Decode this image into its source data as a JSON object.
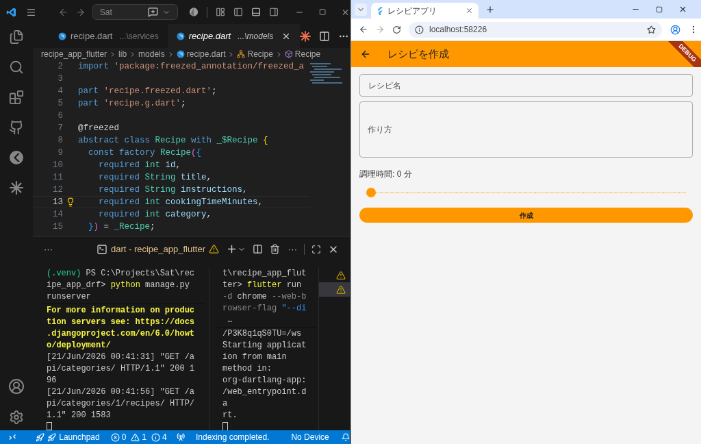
{
  "vscode": {
    "title_bar": {
      "search": "Sat"
    },
    "tabs": [
      {
        "label": "recipe.dart",
        "description": "...\\services",
        "selected": false
      },
      {
        "label": "recipe.dart",
        "description": "...\\models",
        "selected": true
      }
    ],
    "breadcrumbs": [
      {
        "label": "recipe_app_flutter",
        "kind": "folder"
      },
      {
        "label": "lib",
        "kind": "folder"
      },
      {
        "label": "models",
        "kind": "folder"
      },
      {
        "label": "recipe.dart",
        "kind": "file"
      },
      {
        "label": "Recipe",
        "kind": "class"
      },
      {
        "label": "Recipe",
        "kind": "constructor"
      }
    ],
    "code_lines": [
      {
        "n": "2",
        "current": false,
        "tokens": [
          {
            "t": "import ",
            "kind": "kw"
          },
          {
            "t": "'package:freezed_annotation/freezed_a",
            "kind": "str"
          }
        ]
      },
      {
        "n": "3",
        "current": false
      },
      {
        "n": "4",
        "current": false,
        "tokens": [
          {
            "t": "part ",
            "kind": "kw"
          },
          {
            "t": "'recipe.freezed.dart'",
            "kind": "str"
          },
          {
            "t": ";",
            "kind": "punct"
          }
        ]
      },
      {
        "n": "5",
        "current": false,
        "tokens": [
          {
            "t": "part ",
            "kind": "kw"
          },
          {
            "t": "'recipe.g.dart'",
            "kind": "str"
          },
          {
            "t": ";",
            "kind": "punct"
          }
        ]
      },
      {
        "n": "6",
        "current": false
      },
      {
        "n": "7",
        "current": false,
        "tokens": [
          {
            "t": "@freezed",
            "kind": "punct"
          }
        ]
      },
      {
        "n": "8",
        "current": false,
        "tokens": [
          {
            "t": "abstract class ",
            "kind": "kw"
          },
          {
            "t": "Recipe ",
            "kind": "type"
          },
          {
            "t": "with ",
            "kind": "kw"
          },
          {
            "t": "_$Recipe ",
            "kind": "type"
          },
          {
            "t": "{",
            "kind": "b1"
          }
        ]
      },
      {
        "n": "9",
        "current": false,
        "tokens": [
          {
            "t": "  const factory ",
            "kind": "kw"
          },
          {
            "t": "Recipe",
            "kind": "type"
          },
          {
            "t": "(",
            "kind": "b2"
          },
          {
            "t": "{",
            "kind": "b3"
          }
        ]
      },
      {
        "n": "10",
        "current": false,
        "tokens": [
          {
            "t": "    required ",
            "kind": "kw"
          },
          {
            "t": "int ",
            "kind": "type"
          },
          {
            "t": "id",
            "kind": "var"
          },
          {
            "t": ",",
            "kind": "punct"
          }
        ]
      },
      {
        "n": "11",
        "current": false,
        "tokens": [
          {
            "t": "    required ",
            "kind": "kw"
          },
          {
            "t": "String ",
            "kind": "type"
          },
          {
            "t": "title",
            "kind": "var"
          },
          {
            "t": ",",
            "kind": "punct"
          }
        ]
      },
      {
        "n": "12",
        "current": false,
        "tokens": [
          {
            "t": "    required ",
            "kind": "kw"
          },
          {
            "t": "String ",
            "kind": "type"
          },
          {
            "t": "instructions",
            "kind": "var"
          },
          {
            "t": ",",
            "kind": "punct"
          }
        ]
      },
      {
        "n": "13",
        "current": true,
        "tokens": [
          {
            "t": "    required ",
            "kind": "kw"
          },
          {
            "t": "int ",
            "kind": "type"
          },
          {
            "t": "cookingTimeMinutes",
            "kind": "var"
          },
          {
            "t": ",",
            "kind": "punct"
          }
        ]
      },
      {
        "n": "14",
        "current": false,
        "tokens": [
          {
            "t": "    required ",
            "kind": "kw"
          },
          {
            "t": "int ",
            "kind": "type"
          },
          {
            "t": "category",
            "kind": "var"
          },
          {
            "t": ",",
            "kind": "punct"
          }
        ]
      },
      {
        "n": "15",
        "current": false,
        "tokens": [
          {
            "t": "  }",
            "kind": "b3"
          },
          {
            "t": ")",
            "kind": "b2"
          },
          {
            "t": " = ",
            "kind": "punct"
          },
          {
            "t": "_Recipe",
            "kind": "type"
          },
          {
            "t": ";",
            "kind": "punct"
          }
        ]
      }
    ],
    "panel": {
      "more": "···",
      "terminal_tab": "dart - recipe_app_flutter",
      "header_more": "···",
      "left_pane": {
        "command": [
          [
            {
              "t": "(.venv)",
              "kind": "green"
            },
            {
              "t": " PS C:\\Projects\\Sat\\rec",
              "kind": "plain"
            }
          ],
          [
            {
              "t": "ipe_app_drf> ",
              "kind": "plain"
            },
            {
              "t": "python",
              "kind": "yellow"
            },
            {
              "t": " manage.py",
              "kind": "plain"
            }
          ],
          [
            {
              "t": "runserver",
              "kind": "plain"
            }
          ]
        ],
        "output": [
          [
            {
              "t": "For more information on produc",
              "kind": "bold"
            }
          ],
          [
            {
              "t": "tion servers see: https://docs",
              "kind": "bold"
            }
          ],
          [
            {
              "t": ".djangoproject.com/en/6.0/howt",
              "kind": "bold"
            }
          ],
          [
            {
              "t": "o/deployment/",
              "kind": "bold"
            }
          ],
          [
            {
              "t": "[21/Jun/2026 00:41:31] \"GET /a",
              "kind": "plain"
            }
          ],
          [
            {
              "t": "pi/categories/ HTTP/1.1\" 200 1",
              "kind": "plain"
            }
          ],
          [
            {
              "t": "96",
              "kind": "plain"
            }
          ],
          [
            {
              "t": "[21/Jun/2026 00:41:56] \"GET /a",
              "kind": "plain"
            }
          ],
          [
            {
              "t": "pi/categories/1/recipes/ HTTP/",
              "kind": "plain"
            }
          ],
          [
            {
              "t": "1.1\" 200 1583",
              "kind": "plain"
            }
          ]
        ]
      },
      "right_pane": {
        "command": [
          [
            {
              "t": "t\\recipe_app_flut",
              "kind": "plain"
            }
          ],
          [
            {
              "t": "ter> ",
              "kind": "plain"
            },
            {
              "t": "flutter",
              "kind": "yellow"
            },
            {
              "t": " run",
              "kind": "plain"
            }
          ],
          [
            {
              "t": "-d ",
              "kind": "gray"
            },
            {
              "t": "chrome",
              "kind": "plain"
            },
            {
              "t": " --web-b",
              "kind": "gray"
            }
          ],
          [
            {
              "t": "rowser-flag ",
              "kind": "gray"
            },
            {
              "t": "\"--di",
              "kind": "blue"
            }
          ],
          [
            {
              "t": " …",
              "kind": "plain"
            }
          ]
        ],
        "output": [
          [
            {
              "t": "/P3K8q1qS0TU=/ws",
              "kind": "plain"
            }
          ],
          [
            {
              "t": "Starting applicat",
              "kind": "plain"
            }
          ],
          [
            {
              "t": "ion from main",
              "kind": "plain"
            }
          ],
          [
            {
              "t": "method in:",
              "kind": "plain"
            }
          ],
          [
            {
              "t": "org-dartlang-app:",
              "kind": "plain"
            }
          ],
          [
            {
              "t": "/web_entrypoint.d",
              "kind": "plain"
            }
          ],
          [
            {
              "t": "a",
              "kind": "plain"
            }
          ],
          [
            {
              "t": "rt.",
              "kind": "plain"
            }
          ]
        ]
      },
      "terminal_list": [
        {
          "selected": false
        },
        {
          "selected": true
        }
      ]
    },
    "status_bar": {
      "launchpad": "Launchpad",
      "errors": "0",
      "warnings": "1",
      "infos": "4",
      "indexing": "Indexing completed.",
      "device": "No Device"
    }
  },
  "browser": {
    "tab_title": "レシピアプリ",
    "url": "localhost:58226",
    "app": {
      "title": "レシピを作成",
      "debug_banner": "DEBUG",
      "name_field": {
        "placeholder": "レシピ名"
      },
      "instructions_field": {
        "placeholder": "作り方"
      },
      "cooking_time_label": "調理時間: 0 分",
      "slider": {
        "level": 0
      },
      "submit_button": "作成"
    }
  }
}
